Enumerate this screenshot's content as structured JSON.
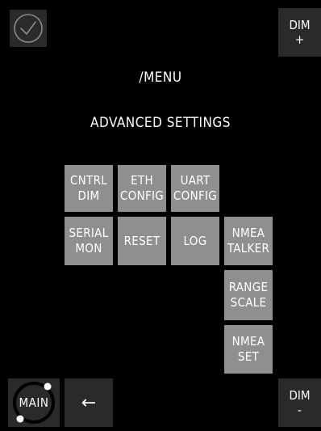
{
  "colors": {
    "background": "#000000",
    "button": "#8f8f8f",
    "corner_button": "#2a2a2a",
    "text": "#ffffff"
  },
  "header": {
    "path": "/MENU",
    "title": "ADVANCED SETTINGS"
  },
  "corners": {
    "dim_plus": "DIM\n+",
    "dim_minus": "DIM\n-",
    "main": "MAIN",
    "back_icon": "←",
    "confirm_icon": "check-circle-icon"
  },
  "buttons": {
    "cntrl_dim": "CNTRL\nDIM",
    "eth_config": "ETH\nCONFIG",
    "uart_config": "UART\nCONFIG",
    "serial_mon": "SERIAL\nMON",
    "reset": "RESET",
    "log": "LOG",
    "nmea_talker": "NMEA\nTALKER",
    "range_scale": "RANGE\nSCALE",
    "nmea_set": "NMEA\nSET"
  }
}
